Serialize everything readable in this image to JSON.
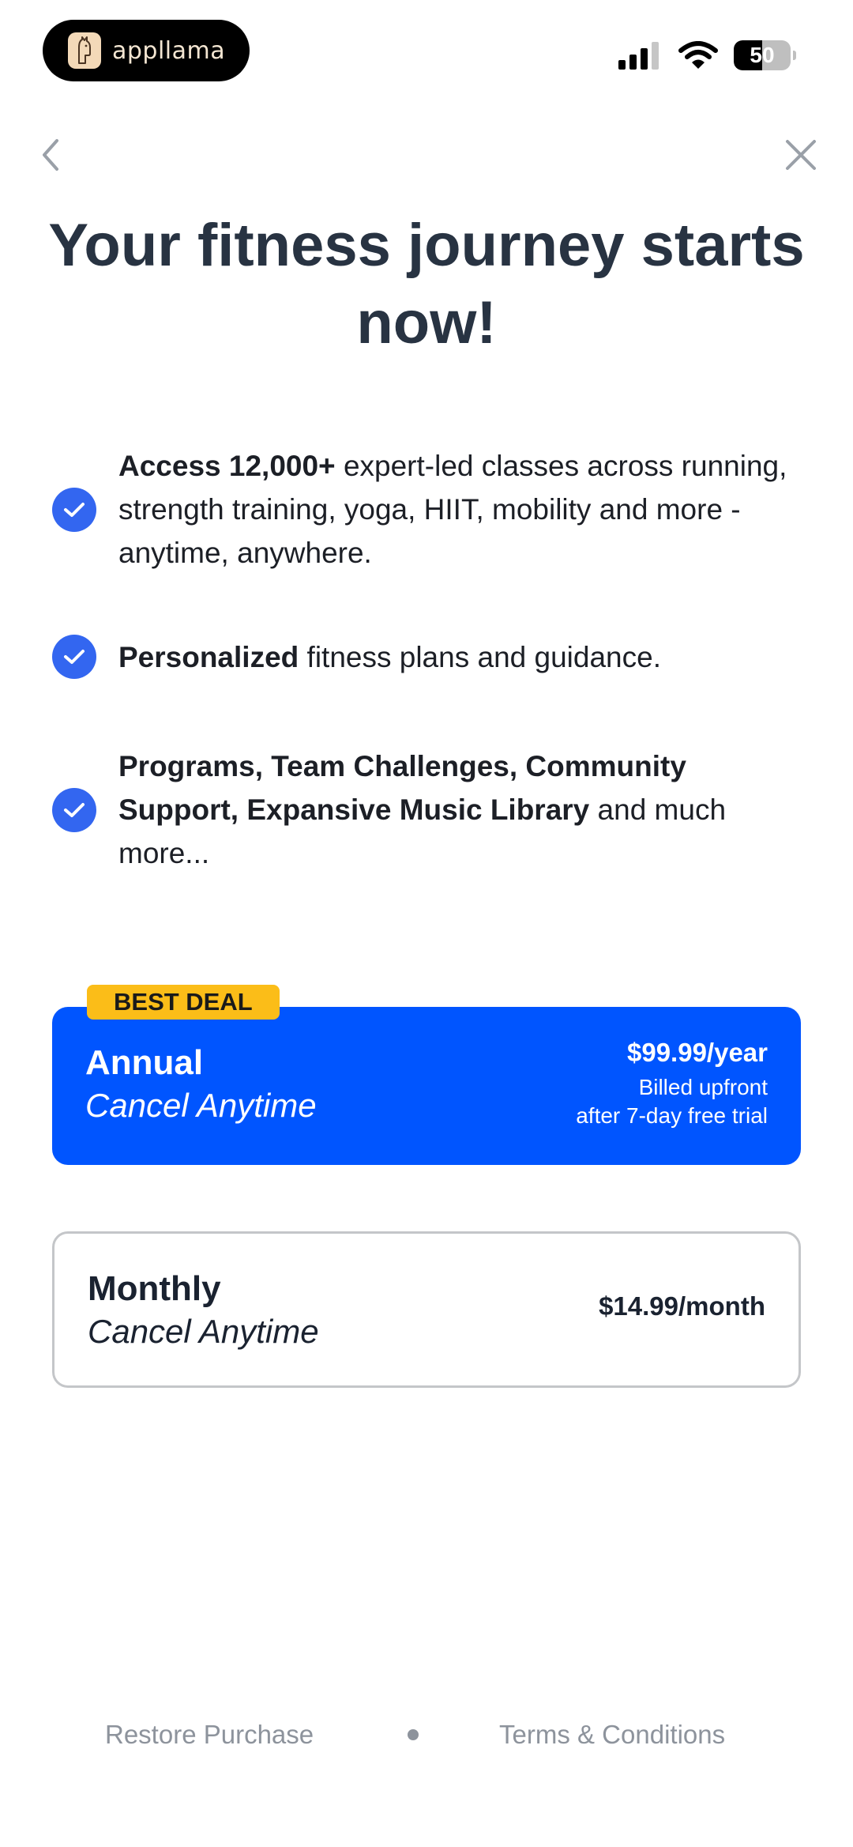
{
  "status_bar": {
    "app_name": "appllama",
    "battery_level": "50",
    "battery_fraction": 0.5,
    "icons": [
      "signal-icon",
      "wifi-icon",
      "battery-icon"
    ]
  },
  "nav": {
    "back_icon": "chevron-left-icon",
    "close_icon": "close-icon"
  },
  "title": "Your fitness journey starts now!",
  "features": [
    {
      "bold": "Access 12,000+",
      "text": " expert-led classes across running, strength training, yoga, HIIT, mobility and more - anytime, anywhere."
    },
    {
      "bold": "Personalized",
      "text": " fitness plans and guidance."
    },
    {
      "bold": "Programs, Team Challenges, Community Support, Expansive Music Library",
      "text": " and much more..."
    }
  ],
  "plans": {
    "badge": "BEST DEAL",
    "annual": {
      "name": "Annual",
      "subtitle": "Cancel Anytime",
      "price": "$99.99/year",
      "note_line1": "Billed upfront",
      "note_line2": "after 7-day free trial"
    },
    "monthly": {
      "name": "Monthly",
      "subtitle": "Cancel Anytime",
      "price": "$14.99/month"
    }
  },
  "footer": {
    "restore": "Restore Purchase",
    "terms": "Terms & Conditions"
  },
  "colors": {
    "accent": "#0055ff",
    "check": "#3366f0",
    "badge": "#fbbd18",
    "title": "#283342",
    "footer_text": "#8d939c"
  }
}
